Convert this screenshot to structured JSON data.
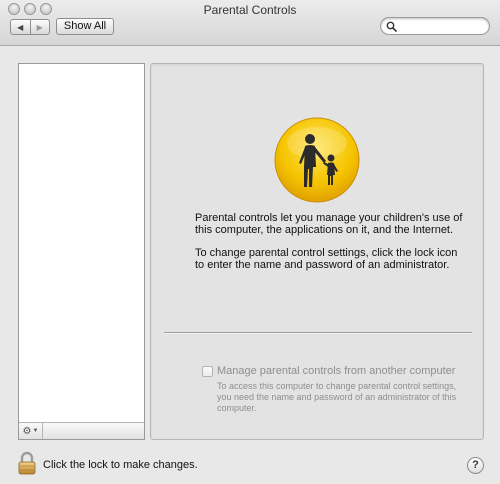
{
  "window": {
    "title": "Parental Controls"
  },
  "toolbar": {
    "back_icon": "back-arrow-icon",
    "forward_icon": "forward-arrow-icon",
    "show_all_label": "Show All",
    "search_value": "",
    "search_placeholder": ""
  },
  "sidebar": {
    "items": [],
    "gear_icon": "gear-icon"
  },
  "main": {
    "icon": "parent-child-icon",
    "description_1": "Parental controls let you manage your children's use of this computer, the applications on it, and the Internet.",
    "description_2": "To change parental control settings, click the lock icon to enter the name and password of an administrator.",
    "remote_checkbox_label": "Manage parental controls from another computer",
    "remote_checkbox_checked": false,
    "remote_description": "To access this computer to change parental control settings, you need the name and password of an administrator of this computer."
  },
  "footer": {
    "lock_icon": "lock-icon",
    "lock_label": "Click the lock to make changes.",
    "help_label": "?"
  },
  "colors": {
    "icon_yellow": "#f5c400",
    "icon_orange": "#e8a200",
    "disabled_text": "#8e8e8e"
  }
}
